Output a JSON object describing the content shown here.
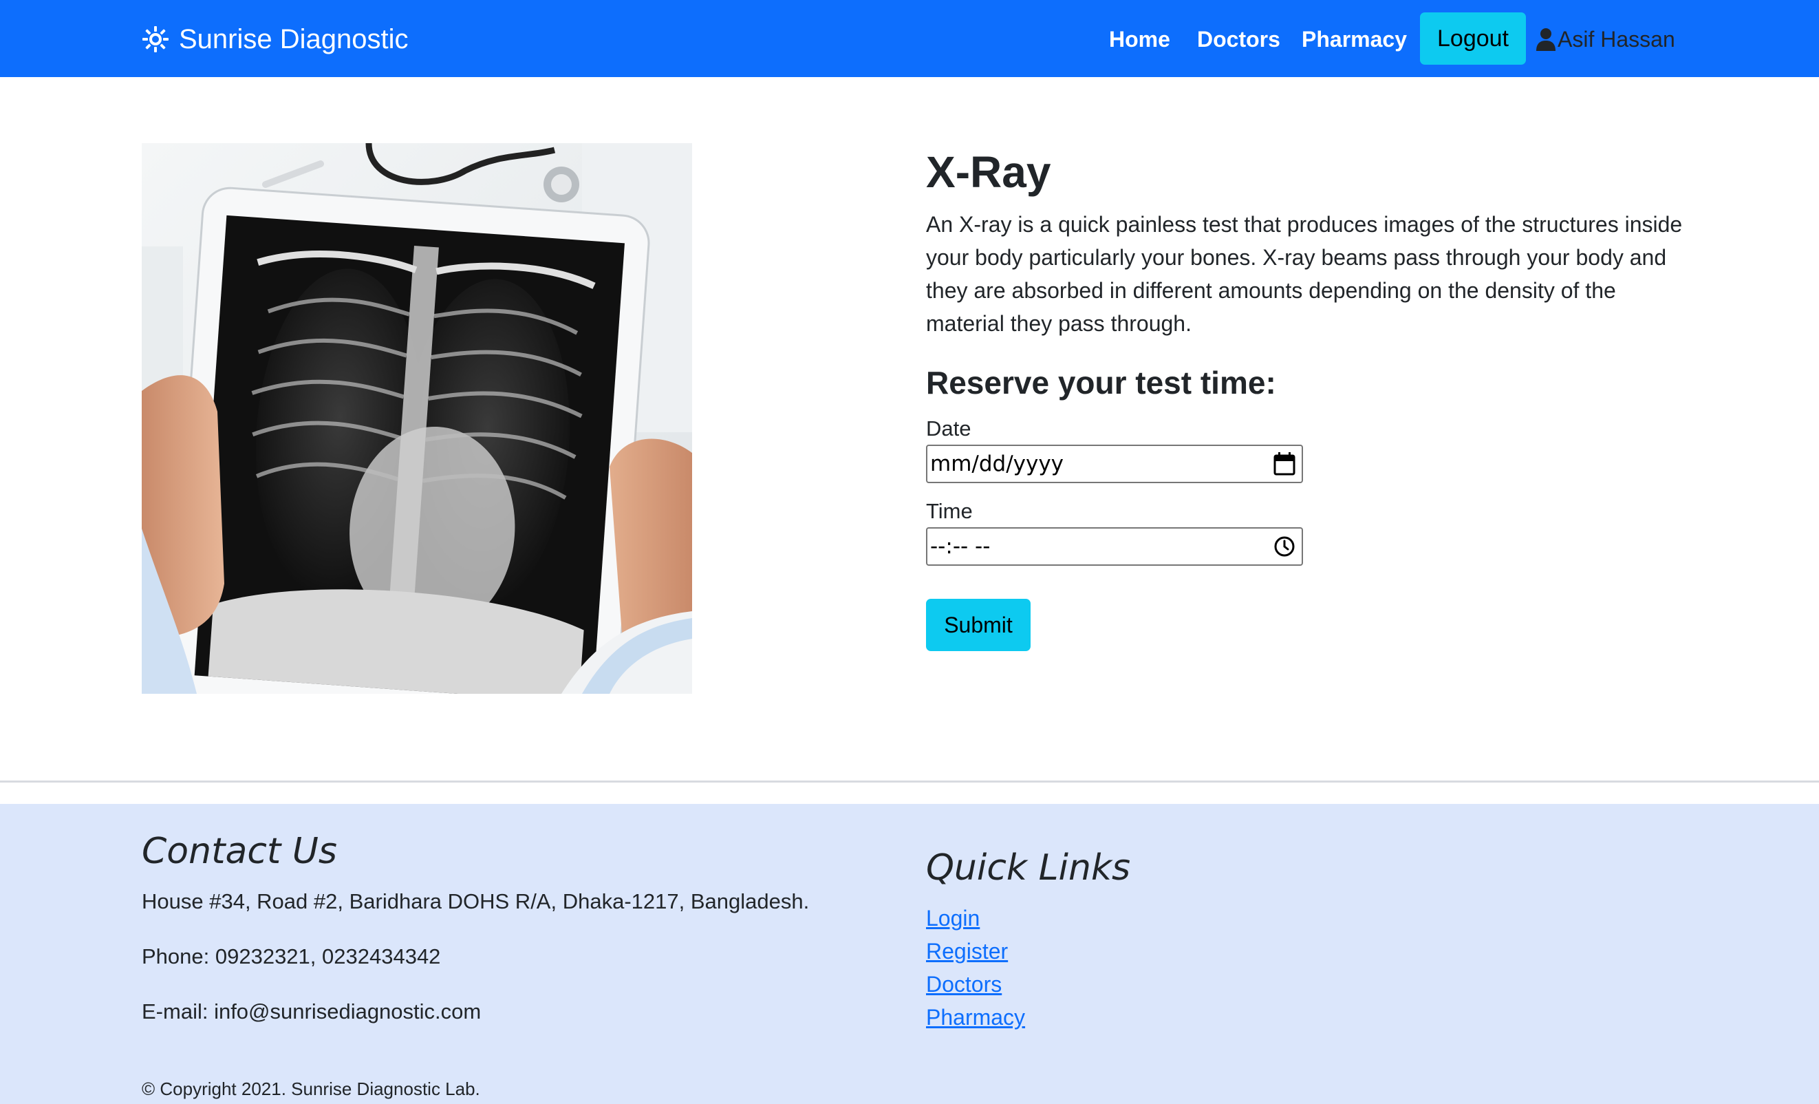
{
  "nav": {
    "brand": "Sunrise Diagnostic",
    "links": [
      "Home",
      "Doctors",
      "Pharmacy"
    ],
    "logout_label": "Logout",
    "user_name": "Asif Hassan"
  },
  "test": {
    "title": "X-Ray",
    "description": "An X-ray is a quick painless test that produces images of the structures inside your body particularly your bones. X-ray beams pass through your body and they are absorbed in different amounts depending on the density of the material they pass through."
  },
  "reserve": {
    "heading": "Reserve your test time:",
    "date_label": "Date",
    "date_value": "mm/dd/yyyy",
    "time_label": "Time",
    "time_value": "--:-- --",
    "submit_label": "Submit"
  },
  "footer": {
    "contact_title": "Contact Us",
    "address": "House #34, Road #2, Baridhara DOHS R/A, Dhaka-1217, Bangladesh.",
    "phone": "Phone: 09232321, 0232434342",
    "email": "E-mail: info@sunrisediagnostic.com",
    "links_title": "Quick Links",
    "links": [
      "Login",
      "Register",
      "Doctors",
      "Pharmacy"
    ],
    "copyright": "© Copyright 2021. Sunrise Diagnostic Lab."
  },
  "colors": {
    "primary": "#0d6efd",
    "info": "#0dcaf0",
    "footer_bg": "#dbe6fb",
    "text": "#212529"
  },
  "icons": {
    "brand": "sun-icon",
    "user": "person-icon",
    "date": "calendar-icon",
    "time": "clock-icon"
  }
}
